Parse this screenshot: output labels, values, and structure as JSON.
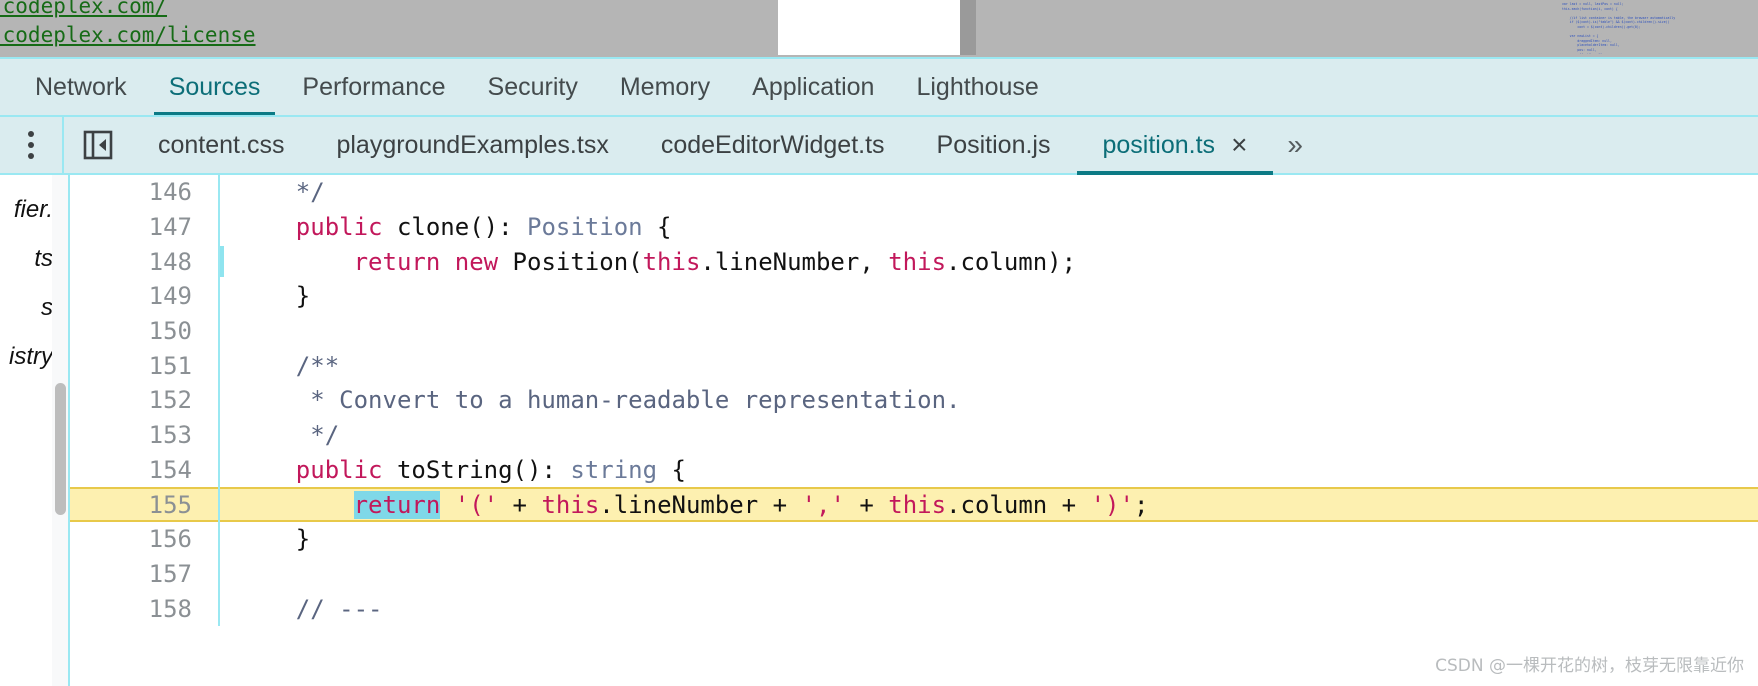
{
  "background_page": {
    "links": [
      ".codeplex.com/",
      ".codeplex.com/license"
    ],
    "thumbnail_code": "var last = null, lastPos = null;\nthis.each(function(i, cont) {\n\n    //if list container is table, the browser automatically\n    if ($(cont).is(\"table\") && $(cont).children().size()\n        cont = $(cont).children().get(0);\n\n    var newList = {\n        draggedItem: null,\n        placeholderItem: null,\n        pos: null,\n        offsetX: null,\n        offsetLimit: null,\n        scroll: null,"
  },
  "panel_tabs": [
    {
      "label": "Network",
      "active": false
    },
    {
      "label": "Sources",
      "active": true
    },
    {
      "label": "Performance",
      "active": false
    },
    {
      "label": "Security",
      "active": false
    },
    {
      "label": "Memory",
      "active": false
    },
    {
      "label": "Application",
      "active": false
    },
    {
      "label": "Lighthouse",
      "active": false
    }
  ],
  "file_tabs": {
    "menu_icon": "more-vertical-icon",
    "collapse_icon": "collapse-sidebar-icon",
    "items": [
      {
        "label": "content.css",
        "active": false
      },
      {
        "label": "playgroundExamples.tsx",
        "active": false
      },
      {
        "label": "codeEditorWidget.ts",
        "active": false
      },
      {
        "label": "Position.js",
        "active": false
      },
      {
        "label": "position.ts",
        "active": true
      }
    ],
    "close_glyph": "×",
    "overflow_glyph": "»"
  },
  "navigator_fragments": [
    "fier.",
    "ts",
    "s",
    "istry"
  ],
  "editor": {
    "filename": "position.ts",
    "selection_text": "return",
    "highlighted_line": 155,
    "lines": [
      {
        "num": 146,
        "tokens": [
          {
            "t": "    */",
            "c": "cmt"
          }
        ]
      },
      {
        "num": 147,
        "tokens": [
          {
            "t": "    ",
            "c": "pln"
          },
          {
            "t": "public",
            "c": "kw"
          },
          {
            "t": " clone(): ",
            "c": "pln"
          },
          {
            "t": "Position",
            "c": "typ"
          },
          {
            "t": " {",
            "c": "pln"
          }
        ]
      },
      {
        "num": 148,
        "cursor": true,
        "tokens": [
          {
            "t": "        ",
            "c": "pln"
          },
          {
            "t": "return new",
            "c": "kw"
          },
          {
            "t": " Position(",
            "c": "pln"
          },
          {
            "t": "this",
            "c": "kw"
          },
          {
            "t": ".lineNumber, ",
            "c": "pln"
          },
          {
            "t": "this",
            "c": "kw"
          },
          {
            "t": ".column);",
            "c": "pln"
          }
        ]
      },
      {
        "num": 149,
        "tokens": [
          {
            "t": "    }",
            "c": "pln"
          }
        ]
      },
      {
        "num": 150,
        "tokens": [
          {
            "t": "",
            "c": "pln"
          }
        ]
      },
      {
        "num": 151,
        "tokens": [
          {
            "t": "    /**",
            "c": "cmt"
          }
        ]
      },
      {
        "num": 152,
        "tokens": [
          {
            "t": "     * Convert to a human-readable representation.",
            "c": "cmt"
          }
        ]
      },
      {
        "num": 153,
        "tokens": [
          {
            "t": "     */",
            "c": "cmt"
          }
        ]
      },
      {
        "num": 154,
        "tokens": [
          {
            "t": "    ",
            "c": "pln"
          },
          {
            "t": "public",
            "c": "kw"
          },
          {
            "t": " toString(): ",
            "c": "pln"
          },
          {
            "t": "string",
            "c": "typ"
          },
          {
            "t": " {",
            "c": "pln"
          }
        ]
      },
      {
        "num": 155,
        "exec": true,
        "tokens": [
          {
            "t": "        ",
            "c": "pln"
          },
          {
            "t": "return",
            "c": "sel"
          },
          {
            "t": " ",
            "c": "pln"
          },
          {
            "t": "'('",
            "c": "str"
          },
          {
            "t": " + ",
            "c": "pln"
          },
          {
            "t": "this",
            "c": "kw"
          },
          {
            "t": ".lineNumber + ",
            "c": "pln"
          },
          {
            "t": "','",
            "c": "str"
          },
          {
            "t": " + ",
            "c": "pln"
          },
          {
            "t": "this",
            "c": "kw"
          },
          {
            "t": ".column + ",
            "c": "pln"
          },
          {
            "t": "')'",
            "c": "str"
          },
          {
            "t": ";",
            "c": "pln"
          }
        ]
      },
      {
        "num": 156,
        "tokens": [
          {
            "t": "    }",
            "c": "pln"
          }
        ]
      },
      {
        "num": 157,
        "tokens": [
          {
            "t": "",
            "c": "pln"
          }
        ]
      },
      {
        "num": 158,
        "tokens": [
          {
            "t": "    // ---",
            "c": "cmt"
          }
        ]
      }
    ]
  },
  "watermark": "CSDN @一棵开花的树，枝芽无限靠近你",
  "colors": {
    "accent_teal": "#0c7a85",
    "tabbar_bg": "#daecef",
    "tabbar_border": "#9ae8f2",
    "exec_highlight": "#fdf0b0",
    "selection": "#7fd8e8",
    "keyword": "#c2185b",
    "type": "#6b7a99",
    "comment": "#5a6580",
    "link_green": "#166b16"
  }
}
